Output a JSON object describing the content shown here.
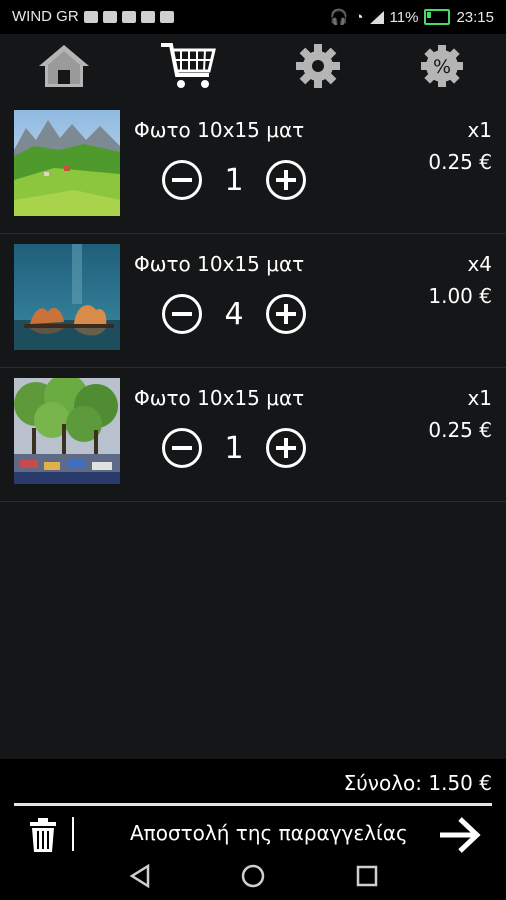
{
  "status_bar": {
    "carrier": "WIND GR",
    "battery": "11%",
    "time": "23:15"
  },
  "toolbar": {
    "home_icon": "home-icon",
    "cart_icon": "cart-icon",
    "settings_icon": "gear-icon",
    "discount_icon": "discount-icon",
    "discount_symbol": "%"
  },
  "cart": {
    "items": [
      {
        "name": "Φωτο 10x15 ματ",
        "quantity": "1",
        "multiplier": "x1",
        "price": "0.25 €",
        "thumbnail": "mountain-meadow"
      },
      {
        "name": "Φωτο 10x15 ματ",
        "quantity": "4",
        "multiplier": "x4",
        "price": "1.00 €",
        "thumbnail": "lake-rocks"
      },
      {
        "name": "Φωτο 10x15 ματ",
        "quantity": "1",
        "multiplier": "x1",
        "price": "0.25 €",
        "thumbnail": "park-trees"
      }
    ]
  },
  "footer": {
    "total": "Σύνολο: 1.50 €",
    "send_label": "Αποστολή της παραγγελίας"
  },
  "colors": {
    "background": "#151617",
    "bars": "#000000",
    "icons": "#b5b5b5",
    "text": "#ffffff",
    "battery": "#4cd964"
  }
}
